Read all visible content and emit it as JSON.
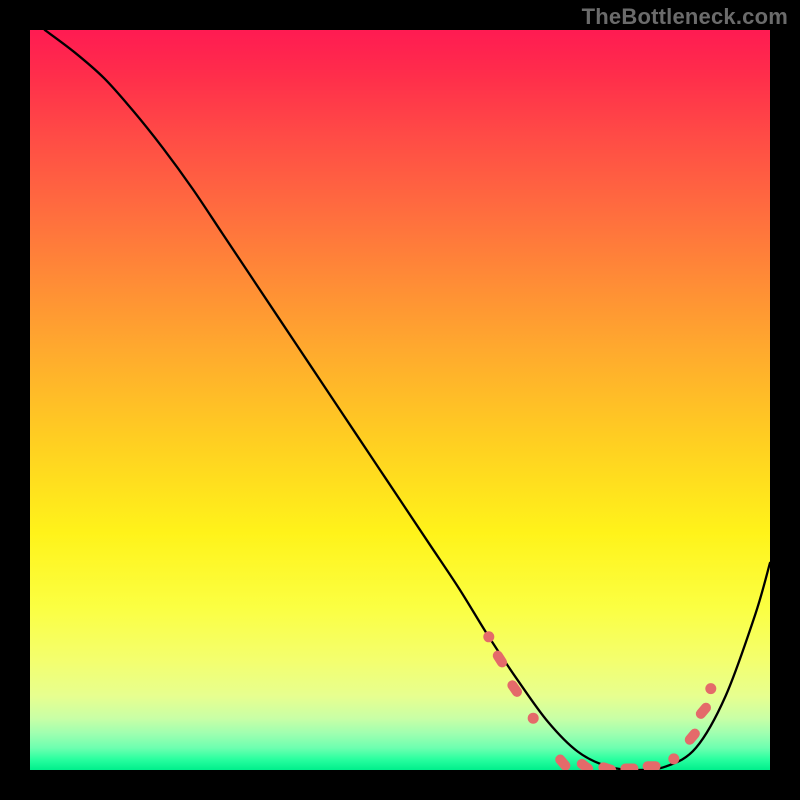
{
  "watermark": "TheBottleneck.com",
  "colors": {
    "background": "#000000",
    "dot_color": "#e46a6a",
    "curve_color": "#000000",
    "gradient_top": "#ff1b52",
    "gradient_bottom": "#00ef8c"
  },
  "chart_data": {
    "type": "line",
    "title": "",
    "xlabel": "",
    "ylabel": "",
    "xlim": [
      0,
      100
    ],
    "ylim": [
      0,
      100
    ],
    "grid": false,
    "legend": false,
    "notes": "Smooth V-shaped curve starting near top-left, descending nearly linearly to a broad flat minimum around x≈70–85, then rising toward top-right. Y decreases downward in plotted pixel space but values here are given with 0 at bottom (floor) and 100 at top.",
    "series": [
      {
        "name": "curve",
        "x": [
          2,
          6,
          10,
          14,
          18,
          22,
          26,
          30,
          34,
          38,
          42,
          46,
          50,
          54,
          58,
          62,
          66,
          70,
          74,
          78,
          82,
          86,
          90,
          94,
          98,
          100
        ],
        "y": [
          100,
          97,
          93.5,
          89,
          84,
          78.5,
          72.5,
          66.5,
          60.5,
          54.5,
          48.5,
          42.5,
          36.5,
          30.5,
          24.5,
          18,
          12,
          6.5,
          2.5,
          0.5,
          0,
          0.5,
          3,
          10,
          21,
          28
        ]
      }
    ],
    "highlight_markers": {
      "description": "Salmon rounded markers clustered along the flat bottom of the curve and partway up each side of the V.",
      "points": [
        {
          "x": 62,
          "y": 18,
          "shape": "dot"
        },
        {
          "x": 63.5,
          "y": 15,
          "shape": "capsule"
        },
        {
          "x": 65.5,
          "y": 11,
          "shape": "capsule"
        },
        {
          "x": 68,
          "y": 7,
          "shape": "dot"
        },
        {
          "x": 72,
          "y": 1,
          "shape": "capsule"
        },
        {
          "x": 75,
          "y": 0.5,
          "shape": "capsule"
        },
        {
          "x": 78,
          "y": 0.2,
          "shape": "capsule"
        },
        {
          "x": 81,
          "y": 0.2,
          "shape": "capsule"
        },
        {
          "x": 84,
          "y": 0.5,
          "shape": "capsule"
        },
        {
          "x": 87,
          "y": 1.5,
          "shape": "dot"
        },
        {
          "x": 89.5,
          "y": 4.5,
          "shape": "capsule"
        },
        {
          "x": 91,
          "y": 8,
          "shape": "capsule"
        },
        {
          "x": 92,
          "y": 11,
          "shape": "dot"
        }
      ]
    }
  }
}
